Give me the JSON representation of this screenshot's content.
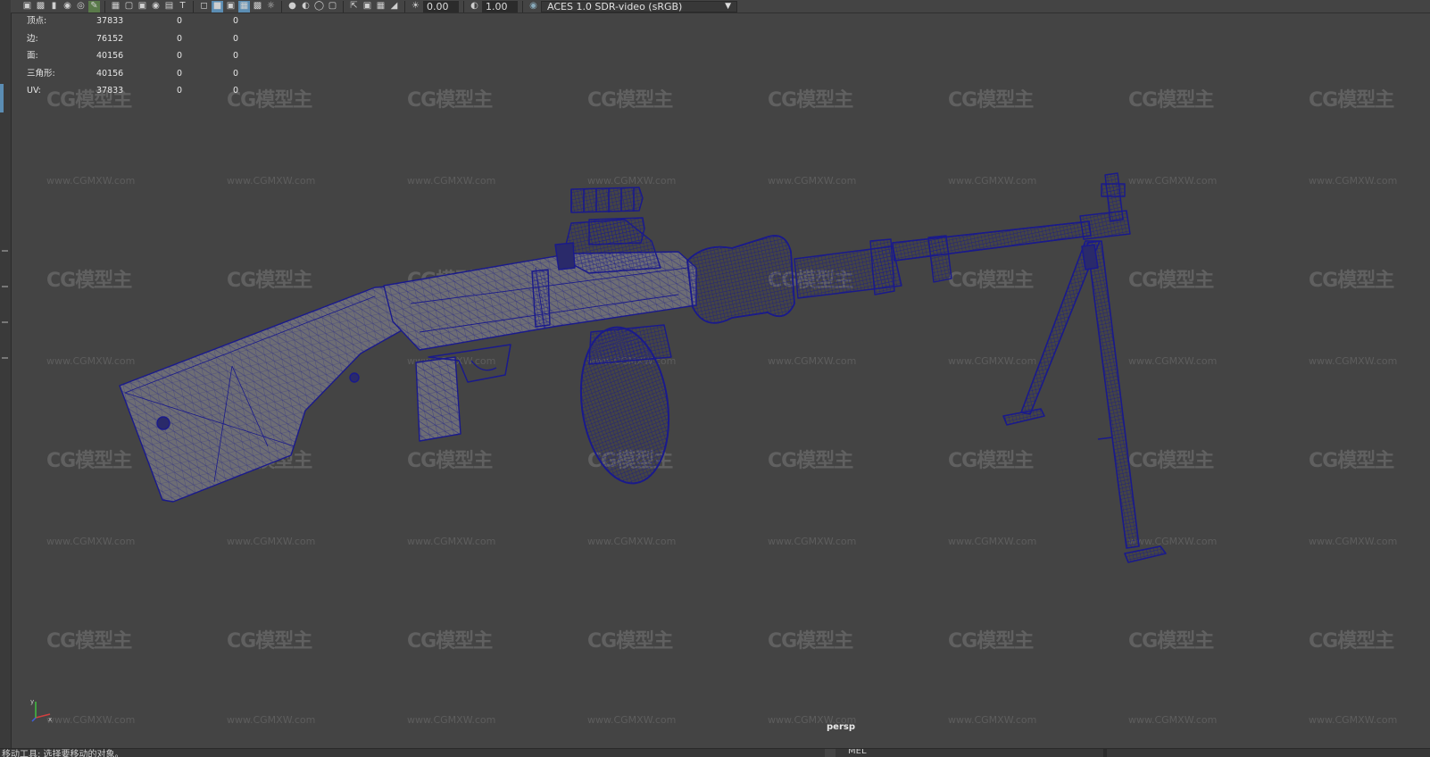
{
  "toolbar": {
    "exposure": "0.00",
    "gamma": "1.00",
    "color_space": "ACES 1.0 SDR-video (sRGB)",
    "icons": [
      "camera-icon",
      "film-icon",
      "bookmark-icon",
      "camera-attributes-icon",
      "image-plane-icon",
      "pencil-icon",
      "grid-icon",
      "film-gate-icon",
      "field-chart-icon",
      "safe-action-icon",
      "safe-title-icon",
      "xray-icon",
      "wireframe-icon",
      "smooth-shade-icon",
      "shaded-wireframe-icon",
      "textured-icon",
      "lights-icon",
      "shadows-icon",
      "ambient-occlusion-icon",
      "motion-blur-icon",
      "antialias-icon",
      "isolate-select-icon",
      "xray-joints-icon",
      "backface-icon",
      "exposure-icon",
      "gamma-icon",
      "color-management-icon"
    ]
  },
  "hud": {
    "rows": [
      {
        "label": "顶点:",
        "v1": "37833",
        "v2": "0",
        "v3": "0"
      },
      {
        "label": "边:",
        "v1": "76152",
        "v2": "0",
        "v3": "0"
      },
      {
        "label": "面:",
        "v1": "40156",
        "v2": "0",
        "v3": "0"
      },
      {
        "label": "三角形:",
        "v1": "40156",
        "v2": "0",
        "v3": "0"
      },
      {
        "label": "UV:",
        "v1": "37833",
        "v2": "0",
        "v3": "0"
      }
    ]
  },
  "viewport": {
    "camera": "persp",
    "wire_color": "#1a1a8c",
    "mesh_fill": "#6a6a72"
  },
  "watermark": {
    "logo": "CG模型主",
    "url": "www.CGMXW.com"
  },
  "statusbar": {
    "message": "移动工具: 选择要移动的对象。",
    "command_label": "MEL"
  }
}
